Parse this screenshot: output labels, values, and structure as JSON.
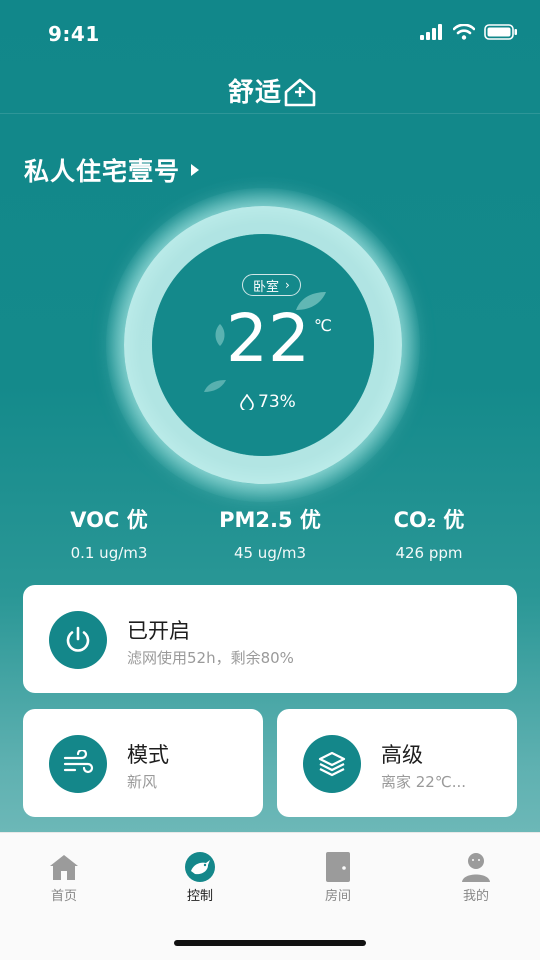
{
  "status_bar": {
    "time": "9:41"
  },
  "header": {
    "logo_text": "舒适"
  },
  "home": {
    "name": "私人住宅壹号"
  },
  "climate": {
    "room": "卧室",
    "temperature": "22",
    "unit": "℃",
    "humidity": "73%"
  },
  "metrics": [
    {
      "title": "VOC 优",
      "value": "0.1 ug/m3"
    },
    {
      "title": "PM2.5 优",
      "value": "45 ug/m3"
    },
    {
      "title": "CO₂ 优",
      "value": "426 ppm"
    }
  ],
  "cards": {
    "power": {
      "title": "已开启",
      "subtitle": "滤网使用52h，剩余80%"
    },
    "mode": {
      "title": "模式",
      "subtitle": "新风"
    },
    "advanced": {
      "title": "高级",
      "subtitle": "离家 22℃..."
    }
  },
  "tabs": [
    {
      "label": "首页",
      "icon": "house-icon"
    },
    {
      "label": "控制",
      "icon": "bird-control-icon",
      "active": true
    },
    {
      "label": "房间",
      "icon": "door-icon"
    },
    {
      "label": "我的",
      "icon": "person-icon"
    }
  ],
  "colors": {
    "accent": "#14878a",
    "card_bg": "#ffffff",
    "muted_text": "#9a9a9a"
  }
}
